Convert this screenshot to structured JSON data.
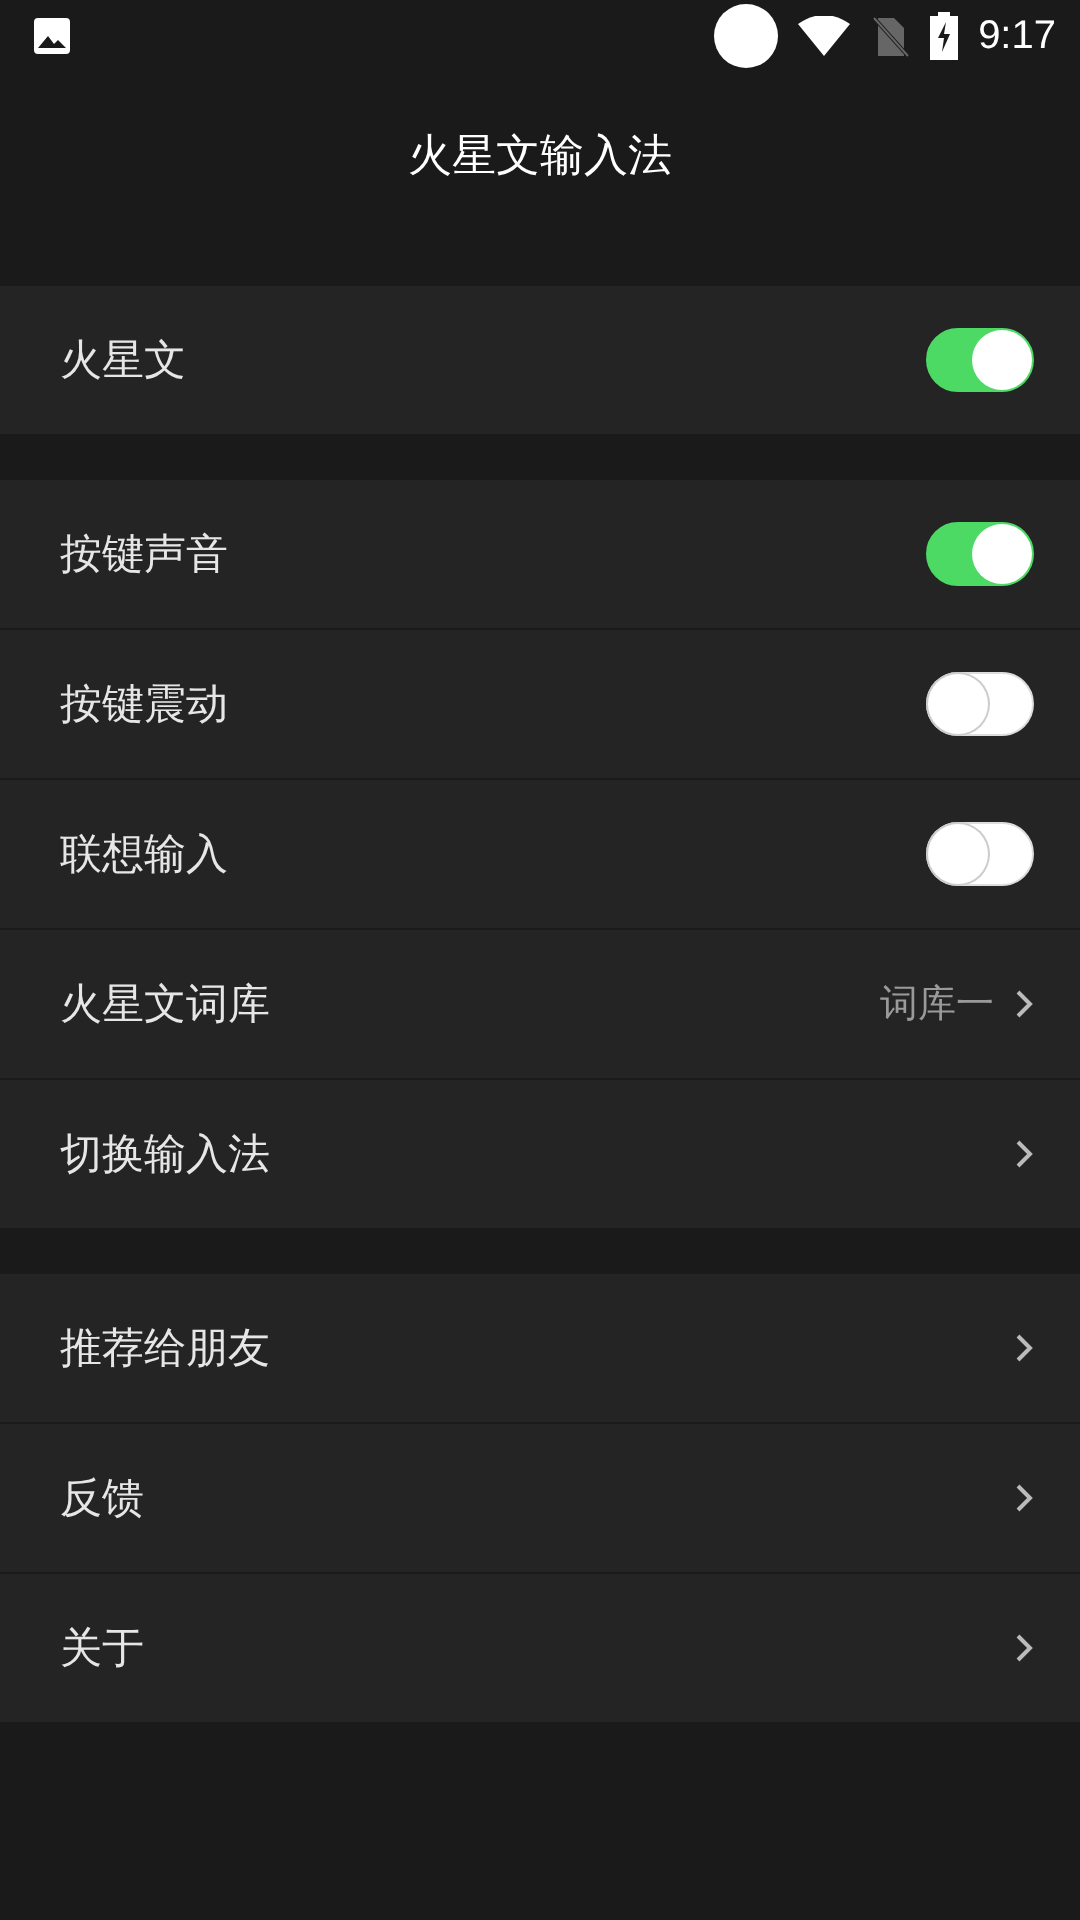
{
  "status_bar": {
    "time": "9:17"
  },
  "title": "火星文输入法",
  "sections": [
    {
      "items": [
        {
          "kind": "toggle",
          "label": "火星文",
          "on": true
        }
      ]
    },
    {
      "items": [
        {
          "kind": "toggle",
          "label": "按键声音",
          "on": true
        },
        {
          "kind": "toggle",
          "label": "按键震动",
          "on": false
        },
        {
          "kind": "toggle",
          "label": "联想输入",
          "on": false
        },
        {
          "kind": "link",
          "label": "火星文词库",
          "value": "词库一"
        },
        {
          "kind": "link",
          "label": "切换输入法"
        }
      ]
    },
    {
      "items": [
        {
          "kind": "link",
          "label": "推荐给朋友"
        },
        {
          "kind": "link",
          "label": "反馈"
        },
        {
          "kind": "link",
          "label": "关于"
        }
      ]
    }
  ]
}
